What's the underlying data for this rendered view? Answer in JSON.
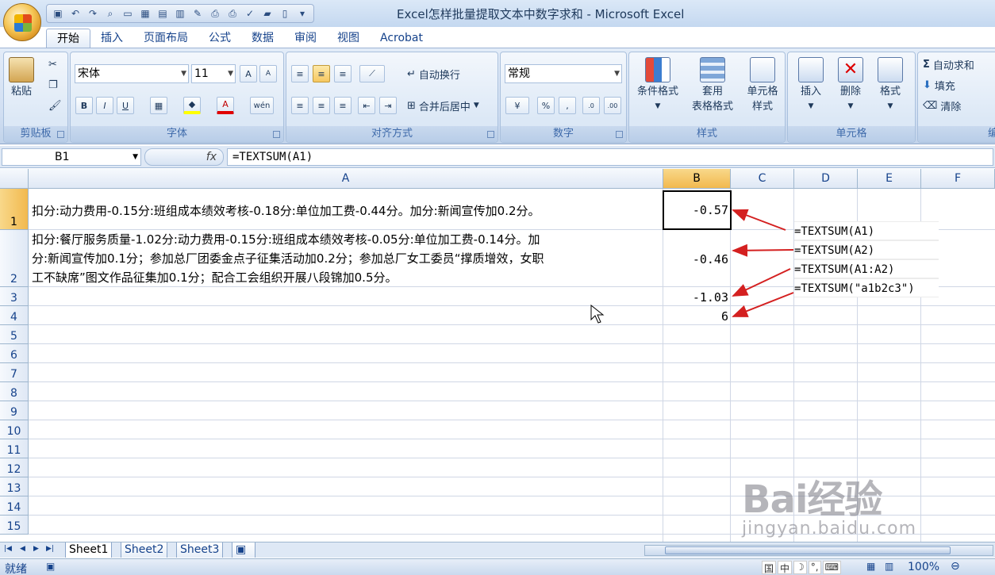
{
  "window": {
    "title": "Excel怎样批量提取文本中数字求和 - Microsoft Excel"
  },
  "quick_access": {
    "icons": [
      "save-icon",
      "undo-icon",
      "redo-icon",
      "print-preview-icon",
      "new-icon",
      "open-icon",
      "print-icon",
      "spelling-icon",
      "customize-icon"
    ]
  },
  "ribbon_tabs": [
    "开始",
    "插入",
    "页面布局",
    "公式",
    "数据",
    "审阅",
    "视图",
    "Acrobat"
  ],
  "active_tab": "开始",
  "ribbon": {
    "clipboard": {
      "label": "剪贴板",
      "paste": "粘贴"
    },
    "font": {
      "label": "字体",
      "font_name": "宋体",
      "font_size": "11",
      "bold": "B",
      "italic": "I",
      "underline": "U",
      "grow": "A",
      "shrink": "A",
      "color_letter": "A",
      "phonetic": "wén"
    },
    "alignment": {
      "label": "对齐方式",
      "wrap": "自动换行",
      "merge": "合并后居中"
    },
    "number": {
      "label": "数字",
      "format": "常规",
      "percent": "%",
      "comma": ","
    },
    "styles": {
      "label": "样式",
      "cond_format": "条件格式",
      "table_format_1": "套用",
      "table_format_2": "表格格式",
      "cell_style_1": "单元格",
      "cell_style_2": "样式"
    },
    "cells": {
      "label": "单元格",
      "insert": "插入",
      "delete": "删除",
      "format": "格式"
    },
    "editing": {
      "autosum": "自动求和",
      "fill": "填充",
      "clear": "清除",
      "label": "编"
    }
  },
  "formula_bar": {
    "name_box": "B1",
    "fx": "fx",
    "formula": "=TEXTSUM(A1)"
  },
  "columns": [
    "A",
    "B",
    "C",
    "D",
    "E",
    "F"
  ],
  "rows": [
    "1",
    "2",
    "3",
    "4",
    "5",
    "6",
    "7",
    "8",
    "9",
    "10",
    "11",
    "12",
    "13",
    "14",
    "15"
  ],
  "cells": {
    "A1": "扣分:动力费用-0.15分:班组成本绩效考核-0.18分:单位加工费-0.44分。加分:新闻宣传加0.2分。",
    "A2_line1": "扣分:餐厅服务质量-1.02分:动力费用-0.15分:班组成本绩效考核-0.05分:单位加工费-0.14分。加",
    "A2_line2": "分:新闻宣传加0.1分；参加总厂团委金点子征集活动加0.2分；参加总厂女工委员“撑质增效，女职",
    "A2_line3": "工不缺席”图文作品征集加0.1分；配合工会组织开展八段锦加0.5分。",
    "B1": "-0.57",
    "B2": "-0.46",
    "B3": "-1.03",
    "B4": "6"
  },
  "annotations": [
    "=TEXTSUM(A1)",
    "=TEXTSUM(A2)",
    "=TEXTSUM(A1:A2)",
    "=TEXTSUM(\"a1b2c3\")"
  ],
  "arrow_color": "#d42020",
  "sheet_tabs": [
    "Sheet1",
    "Sheet2",
    "Sheet3"
  ],
  "active_sheet": "Sheet1",
  "status": {
    "ready": "就绪",
    "zoom": "100%",
    "ime": [
      "国",
      "中",
      "☽",
      "°,",
      "⌨"
    ]
  },
  "watermark": {
    "logo": "Bai经验",
    "url": "jingyan.baidu.com"
  }
}
